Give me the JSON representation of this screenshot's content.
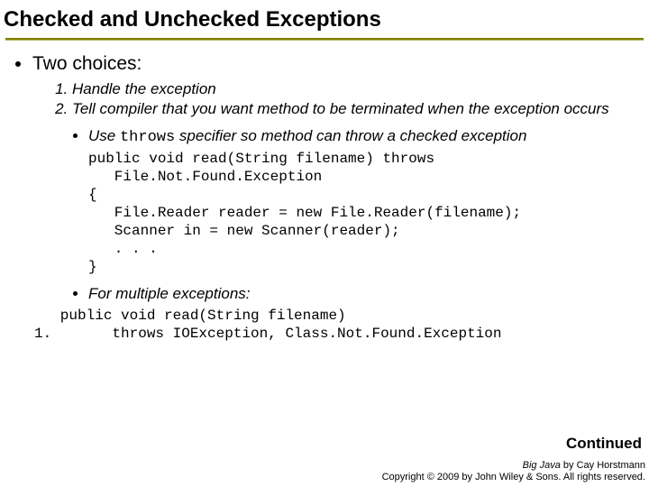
{
  "title": "Checked and Unchecked Exceptions",
  "bullet1": "Two choices:",
  "item1": "Handle the exception",
  "item2": "Tell compiler that you want method to be terminated when the exception occurs",
  "sub1_pre": "Use ",
  "sub1_code": "throws",
  "sub1_post": " specifier so method can throw a checked exception",
  "code1": "public void read(String filename) throws\n   File.Not.Found.Exception\n{\n   File.Reader reader = new File.Reader(filename);\n   Scanner in = new Scanner(reader);\n   . . .\n}",
  "sub2": "For multiple exceptions:",
  "code2": "   public void read(String filename)\n1.       throws IOException, Class.Not.Found.Exception",
  "continued": "Continued",
  "footer_book": "Big Java",
  "footer_by": " by Cay Horstmann",
  "footer_copy": "Copyright © 2009 by John Wiley & Sons. All rights reserved."
}
